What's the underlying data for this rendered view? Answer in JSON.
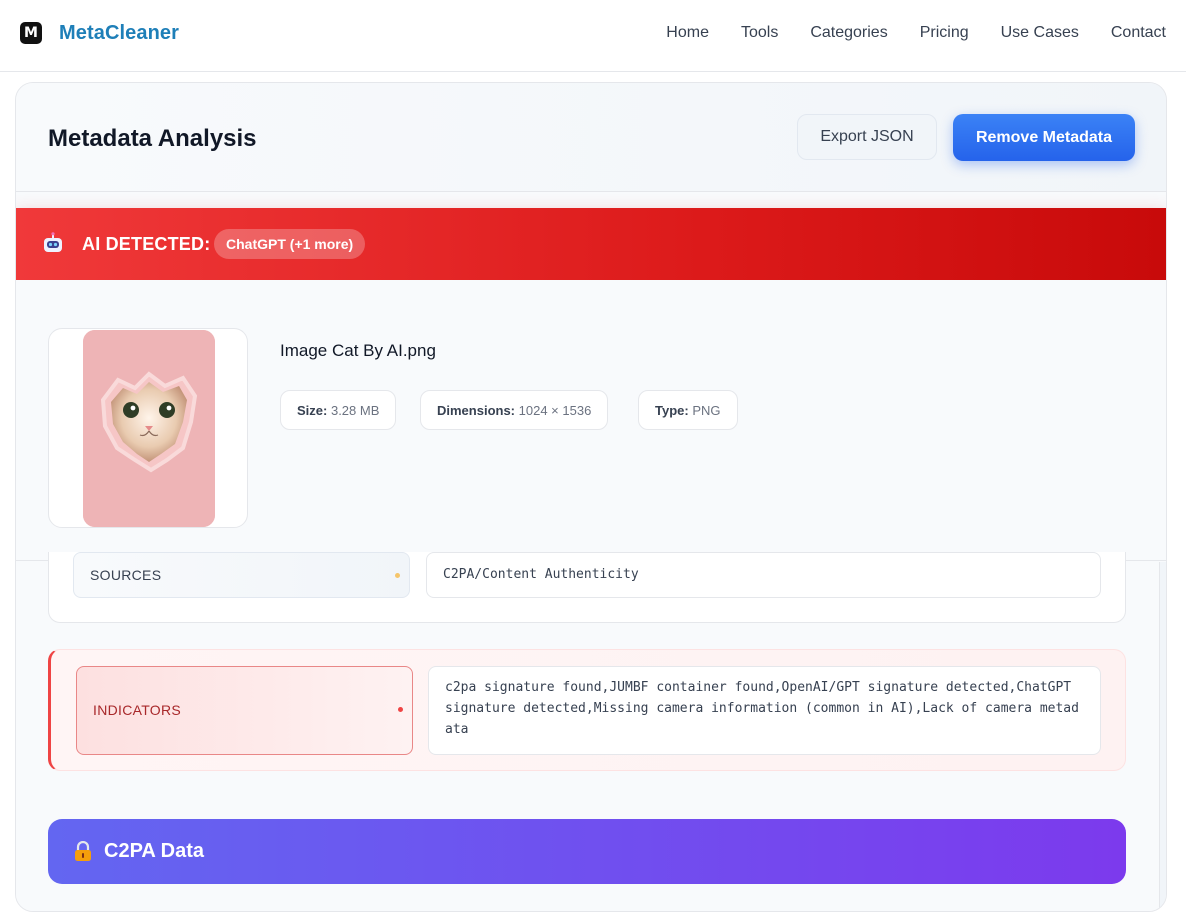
{
  "brand": {
    "logo_letter": "M",
    "name": "MetaCleaner"
  },
  "nav": [
    "Home",
    "Tools",
    "Categories",
    "Pricing",
    "Use Cases",
    "Contact"
  ],
  "header": {
    "title": "Metadata Analysis",
    "export_label": "Export JSON",
    "remove_label": "Remove Metadata"
  },
  "ai_banner": {
    "label": "AI DETECTED:",
    "detail": "ChatGPT (+1 more)",
    "color": "#dc2626"
  },
  "file": {
    "name": "Image Cat By AI.png",
    "size_label": "Size:",
    "size": "3.28 MB",
    "dimensions_label": "Dimensions:",
    "dimensions": "1024 × 1536",
    "type_label": "Type:",
    "type": "PNG"
  },
  "metadata": {
    "sources_key": "SOURCES",
    "sources_value": "C2PA/Content Authenticity",
    "indicators_key": "INDICATORS",
    "indicators_value": "c2pa signature found,JUMBF container found,OpenAI/GPT signature detected,ChatGPT signature detected,Missing camera information (common in AI),Lack of camera metadata"
  },
  "c2pa": {
    "title": "C2PA Data",
    "accent": "#7c3aed"
  }
}
